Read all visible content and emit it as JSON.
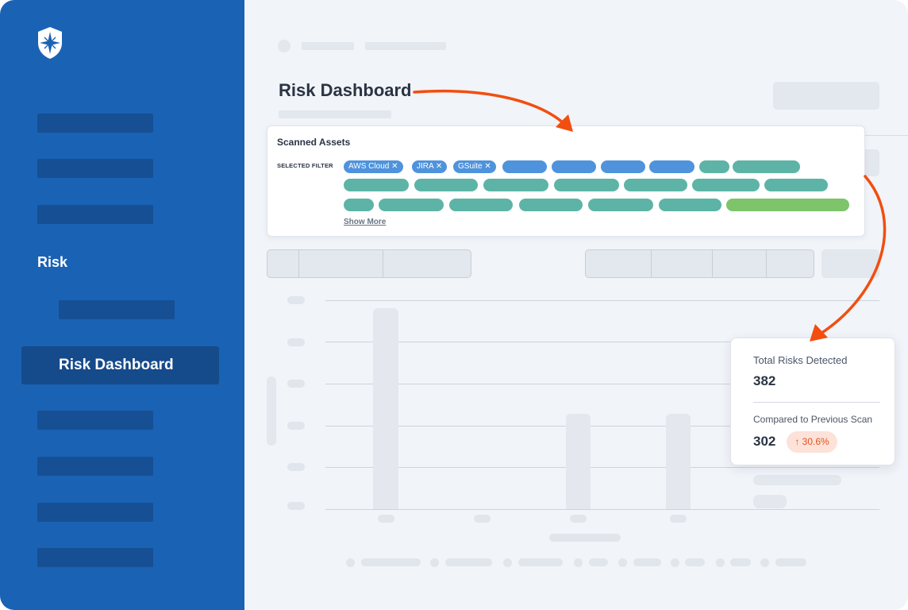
{
  "sidebar": {
    "nav_section": "Risk",
    "active_item": "Risk Dashboard"
  },
  "page": {
    "title": "Risk Dashboard"
  },
  "scanned_assets": {
    "title": "Scanned Assets",
    "filter_label": "SELECTED FILTER",
    "tags": [
      "AWS Cloud",
      "JIRA",
      "GSuite"
    ],
    "remove_icon": "close-icon",
    "show_more": "Show More"
  },
  "stats": {
    "total_label": "Total Risks Detected",
    "total_value": "382",
    "compare_label": "Compared to Previous Scan",
    "compare_value": "302",
    "change": "30.6%",
    "change_icon": "arrow-up-icon"
  },
  "colors": {
    "sidebar": "#1a62b4",
    "sidebar_bar": "#164f93",
    "accent_arrow": "#f24e0f",
    "tag_blue": "#4f93dd",
    "tag_teal": "#5db4a6",
    "tag_green": "#7dc46b",
    "badge_bg": "#fde2da",
    "badge_text": "#e3541a"
  }
}
